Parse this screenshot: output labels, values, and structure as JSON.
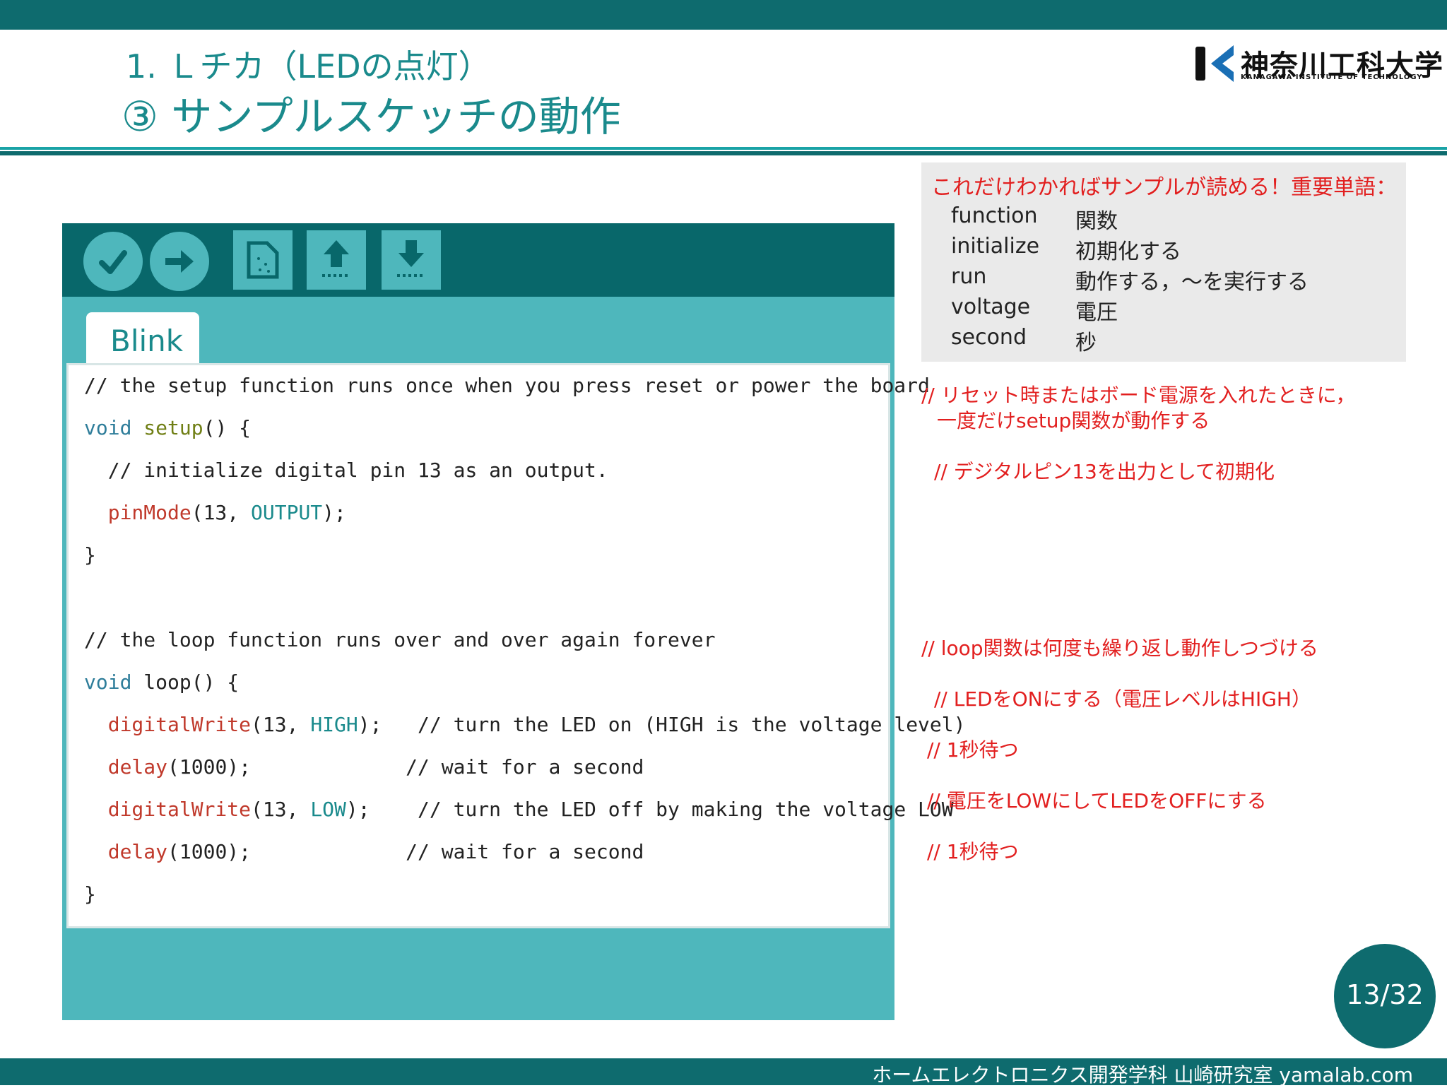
{
  "header": {
    "subtitle": "1. Ｌチカ（LEDの点灯）",
    "title": "③ サンプルスケッチの動作"
  },
  "logo": {
    "name": "神奈川工科大学",
    "sub": "KANAGAWA INSTITUTE OF TECHNOLOGY"
  },
  "ide": {
    "toolbar": [
      {
        "name": "verify-icon"
      },
      {
        "name": "upload-arrow-icon"
      },
      {
        "name": "new-file-icon"
      },
      {
        "name": "open-file-icon"
      },
      {
        "name": "save-file-icon"
      }
    ],
    "tab_label": "Blink"
  },
  "code": {
    "line1": "// the setup function runs once when you press reset or power the board",
    "line2_void": "void",
    "line2_fn": "setup",
    "line2_rest": "() {",
    "line3": "  // initialize digital pin 13 as an output.",
    "line4_fn": "  pinMode",
    "line4_mid": "(13, ",
    "line4_const": "OUTPUT",
    "line4_end": ");",
    "line5": "}",
    "line6": "// the loop function runs over and over again forever",
    "line7_void": "void",
    "line7_rest": " loop() {",
    "line8_fn": "  digitalWrite",
    "line8_mid": "(13, ",
    "line8_const": "HIGH",
    "line8_end": ");   // turn the LED on (HIGH is the voltage level)",
    "line9_fn": "  delay",
    "line9_end": "(1000);             // wait for a second",
    "line10_fn": "  digitalWrite",
    "line10_mid": "(13, ",
    "line10_const": "LOW",
    "line10_end": ");    // turn the LED off by making the voltage LOW",
    "line11_fn": "  delay",
    "line11_end": "(1000);             // wait for a second",
    "line12": "}"
  },
  "glossary": {
    "title": "これだけわかればサンプルが読める！重要単語：",
    "items": [
      {
        "term": "function",
        "meaning": "関数"
      },
      {
        "term": "initialize",
        "meaning": "初期化する"
      },
      {
        "term": "run",
        "meaning": "動作する，～を実行する"
      },
      {
        "term": "voltage",
        "meaning": "電圧"
      },
      {
        "term": "second",
        "meaning": "秒"
      }
    ]
  },
  "notes": {
    "n1a": "// リセット時またはボード電源を入れたときに，",
    "n1b": "一度だけsetup関数が動作する",
    "n2": "// デジタルピン13を出力として初期化",
    "n3": "// loop関数は何度も繰り返し動作しつづける",
    "n4": "// LEDをONにする（電圧レベルはHIGH）",
    "n5": "// 1秒待つ",
    "n6": "// 電圧をLOWにしてLEDをOFFにする",
    "n7": "// 1秒待つ"
  },
  "page": {
    "number": "13/32"
  },
  "footer": {
    "text": "ホームエレクトロニクス開発学科 山崎研究室 yamalab.com"
  },
  "colors": {
    "brand_teal": "#0e6b6e",
    "ide_teal": "#4eb7bc",
    "note_red": "#e21f1f"
  }
}
